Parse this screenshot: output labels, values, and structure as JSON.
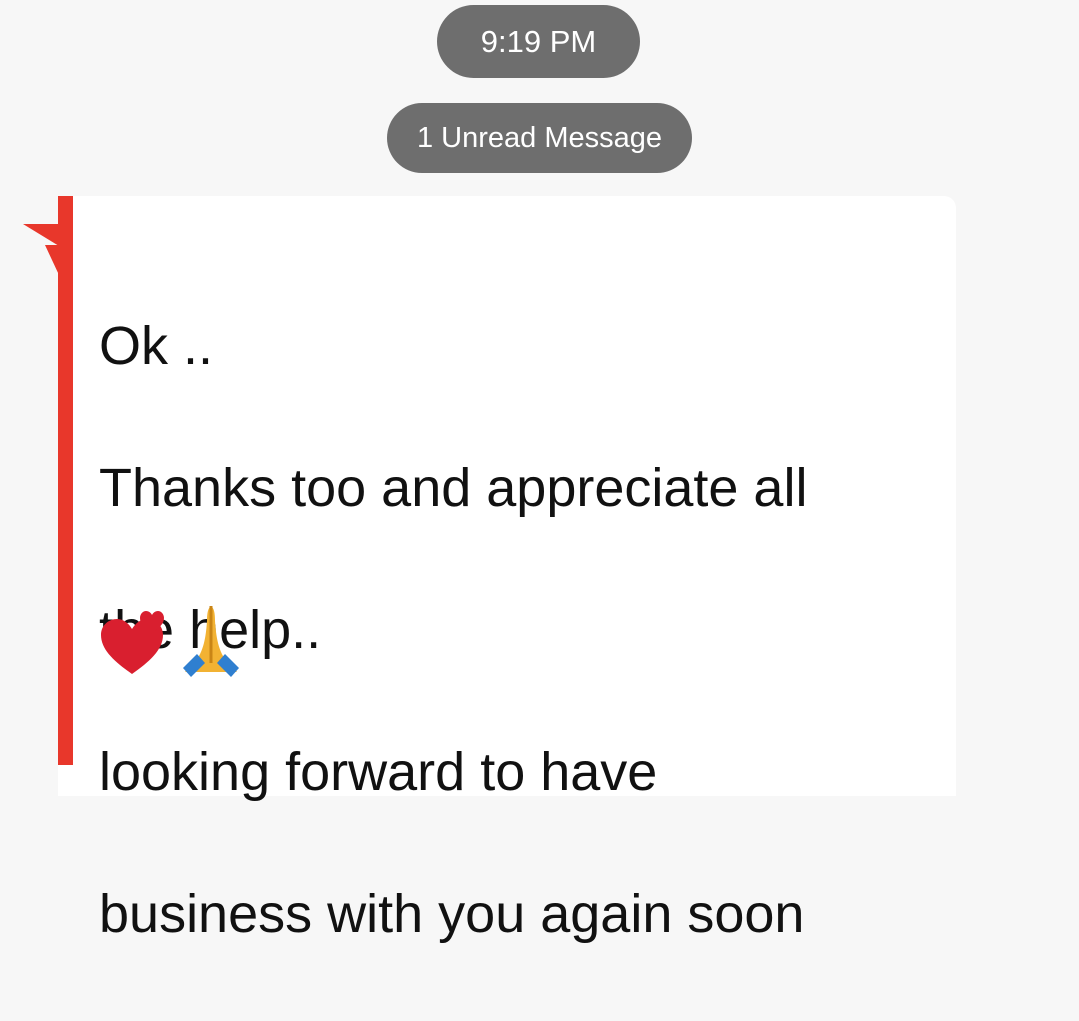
{
  "header": {
    "timestamp": "9:19 PM",
    "unread_label": "1 Unread Message"
  },
  "message": {
    "lines": [
      "Ok ..",
      "Thanks too and appreciate all",
      "the help..",
      "looking forward to have",
      "business with you again soon"
    ],
    "emojis": [
      "two-hearts-icon",
      "folded-hands-icon"
    ]
  },
  "colors": {
    "background": "#f7f7f7",
    "pill": "#6e6e6e",
    "accent_bar": "#e8372b",
    "bubble": "#ffffff",
    "text": "#111111"
  }
}
